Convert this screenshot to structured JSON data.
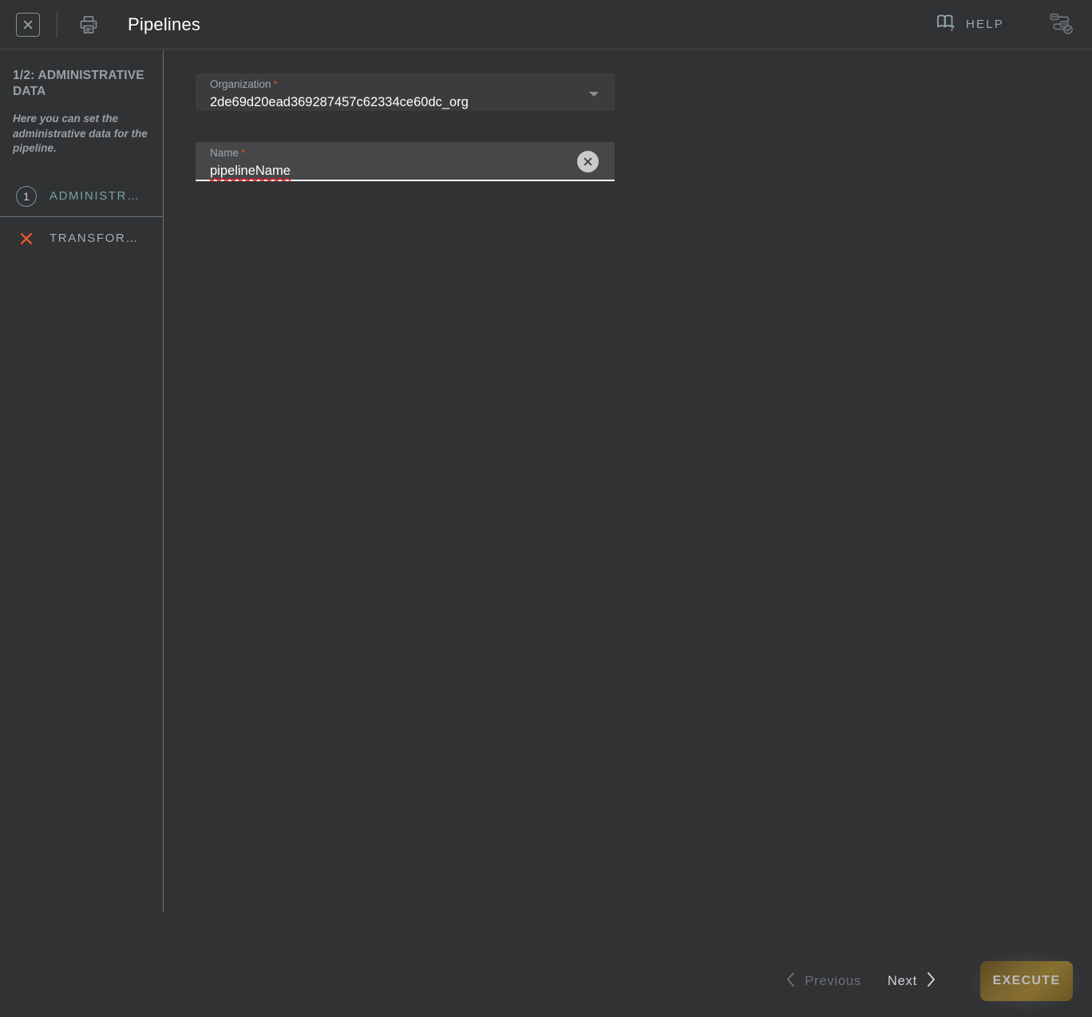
{
  "header": {
    "title": "Pipelines",
    "close_icon": "close-box-icon",
    "print_icon": "printer-icon",
    "help_label": "HELP",
    "help_icon": "book-question-icon",
    "pipeline_icon": "pipeline-check-icon"
  },
  "sidebar": {
    "step_title": "1/2: ADMINISTRATIVE DATA",
    "description": "Here you can set the administrative data for the pipeline.",
    "steps": [
      {
        "marker": "1",
        "marker_type": "number",
        "label": "ADMINISTR…",
        "state": "active"
      },
      {
        "marker": "✕",
        "marker_type": "error-x-icon",
        "label": "TRANSFOR…",
        "state": "error"
      }
    ]
  },
  "form": {
    "organization": {
      "label": "Organization",
      "required_marker": "*",
      "value": "2de69d20ead369287457c62334ce60dc_org",
      "caret_icon": "chevron-down-icon"
    },
    "name": {
      "label": "Name",
      "required_marker": "*",
      "value": "pipelineName",
      "clear_icon": "close-circle-icon"
    }
  },
  "footer": {
    "previous_label": "Previous",
    "previous_icon": "chevron-left-icon",
    "next_label": "Next",
    "next_icon": "chevron-right-icon",
    "execute_label": "EXECUTE"
  },
  "colors": {
    "background": "#303234",
    "accent_teal": "#6f9b97",
    "error_red": "#e4552a",
    "help_blue": "#93aab0",
    "execute_gold": "#7c6530",
    "spellcheck_red": "#e01b1b"
  }
}
